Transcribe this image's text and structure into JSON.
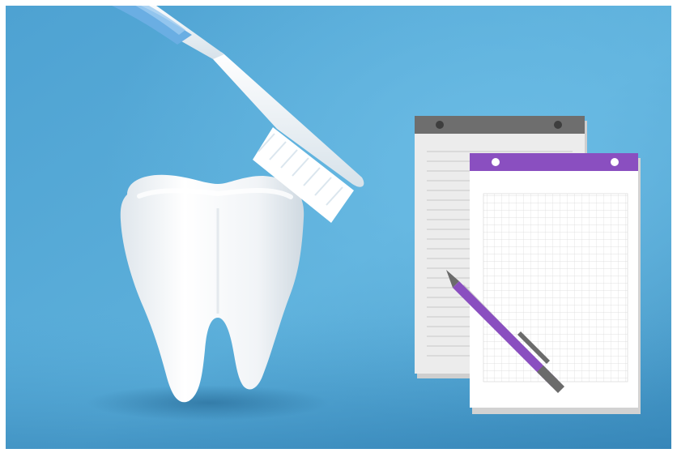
{
  "scene": {
    "subject": "dental-care-and-notepads-illustration",
    "colors": {
      "background_light": "#5db0db",
      "background_dark": "#3f8fbf",
      "tooth": "#f4f6f8",
      "toothbrush_handle": "#f5f7f9",
      "toothbrush_accent": "#6aaee3",
      "bristles": "#ffffff",
      "notepad_back_header": "#6e6e6e",
      "notepad_back_paper": "#e9e9e9",
      "notepad_front_header": "#8a4fc0",
      "notepad_front_paper": "#ffffff",
      "pen_body": "#8a4fc0",
      "pen_clip": "#6b6b6b"
    },
    "icons": {
      "tooth": "tooth-icon",
      "toothbrush": "toothbrush-icon",
      "lined_notepad": "lined-notepad-icon",
      "grid_notepad": "grid-notepad-icon",
      "pen": "pen-icon"
    }
  }
}
